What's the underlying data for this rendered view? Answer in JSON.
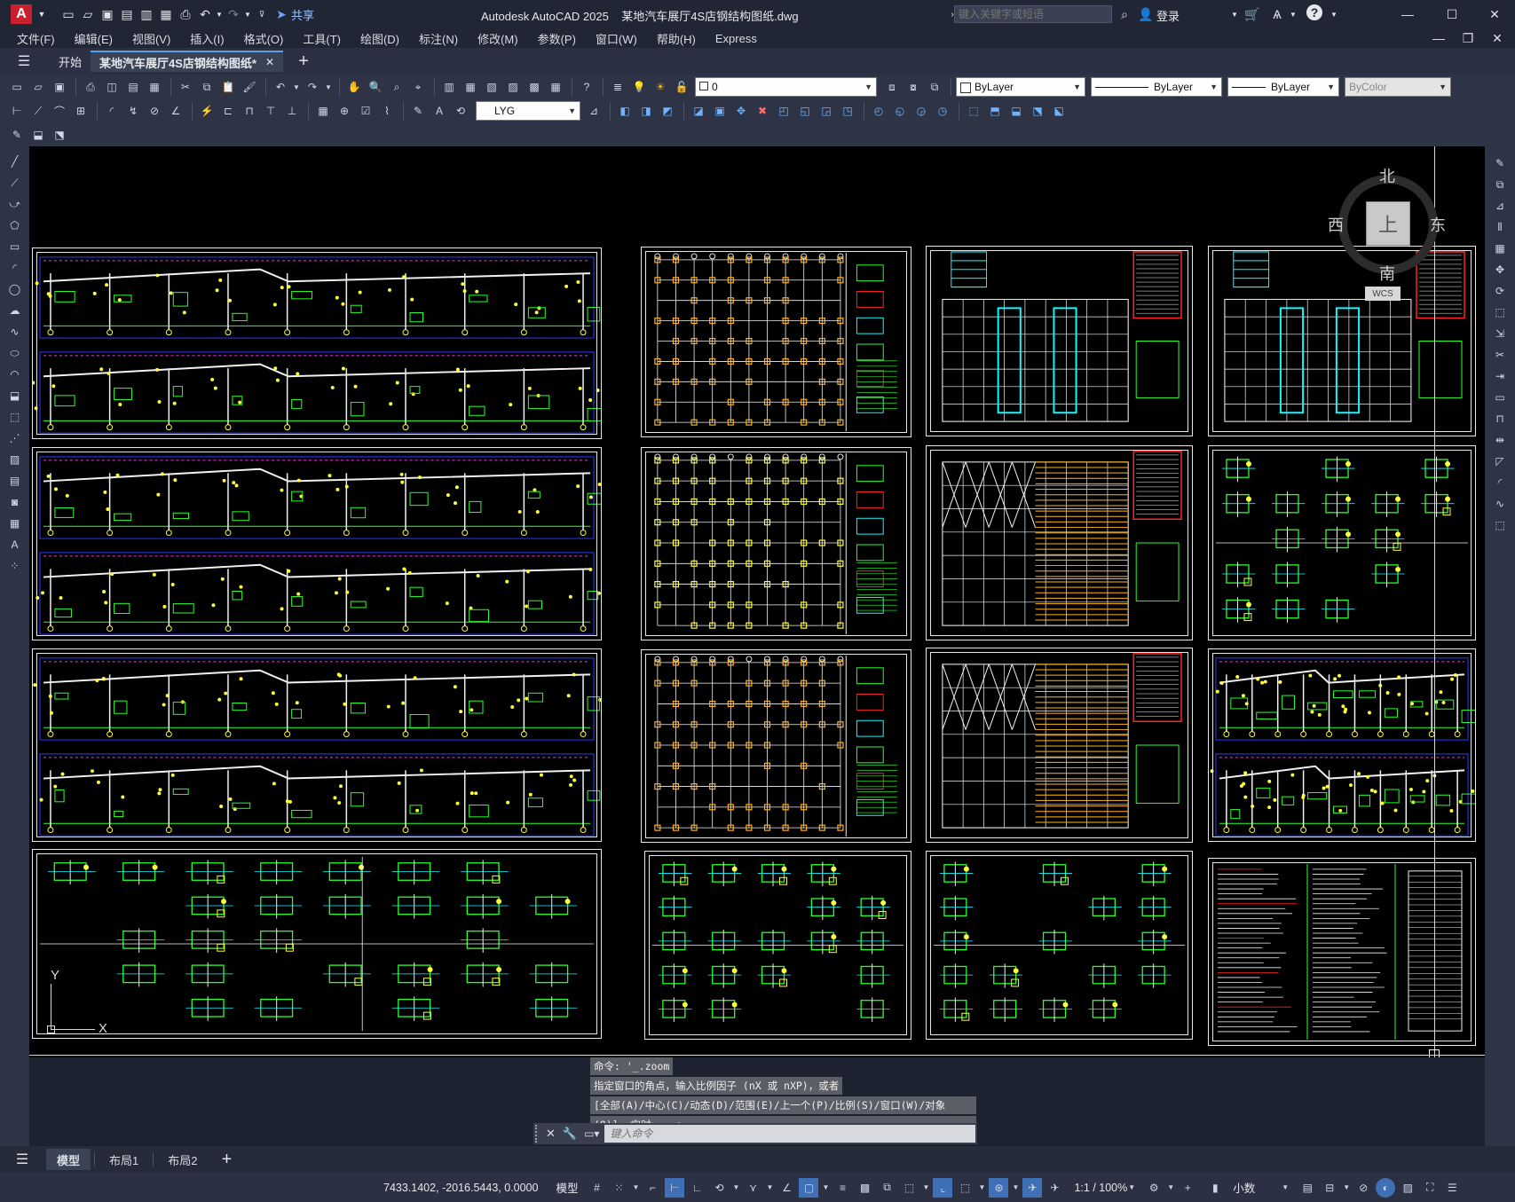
{
  "app": {
    "logo": "A",
    "title": "Autodesk AutoCAD 2025",
    "filename": "某地汽车展厅4S店钢结构图纸.dwg",
    "share_label": "共享",
    "search_placeholder": "键入关键字或短语",
    "login_label": "登录"
  },
  "menu": [
    "文件(F)",
    "编辑(E)",
    "视图(V)",
    "插入(I)",
    "格式(O)",
    "工具(T)",
    "绘图(D)",
    "标注(N)",
    "修改(M)",
    "参数(P)",
    "窗口(W)",
    "帮助(H)",
    "Express"
  ],
  "tabs": {
    "start": "开始",
    "active": "某地汽车展厅4S店钢结构图纸*",
    "add": "+"
  },
  "layer": {
    "current": "0"
  },
  "properties": {
    "color": "ByLayer",
    "linetype": "ByLayer",
    "lineweight": "ByLayer",
    "plotstyle": "ByColor"
  },
  "dimstyle": {
    "current": "LYG"
  },
  "viewcube": {
    "north": "北",
    "south": "南",
    "east": "东",
    "west": "西",
    "top": "上",
    "wcs": "WCS"
  },
  "ucs": {
    "x": "X",
    "y": "Y"
  },
  "command": {
    "history": [
      "命令: '_.zoom",
      "指定窗口的角点，输入比例因子 (nX 或 nXP)，或者",
      "[全部(A)/中心(C)/动态(D)/范围(E)/上一个(P)/比例(S)/窗口(W)/对象",
      "(O)] <实时>: _e"
    ],
    "placeholder": "键入命令"
  },
  "layouts": {
    "model": "模型",
    "layout1": "布局1",
    "layout2": "布局2",
    "add": "+"
  },
  "status": {
    "coords": "7433.1402, -2016.5443, 0.0000",
    "space": "模型",
    "scale": "1:1 / 100%",
    "units": "小数"
  }
}
